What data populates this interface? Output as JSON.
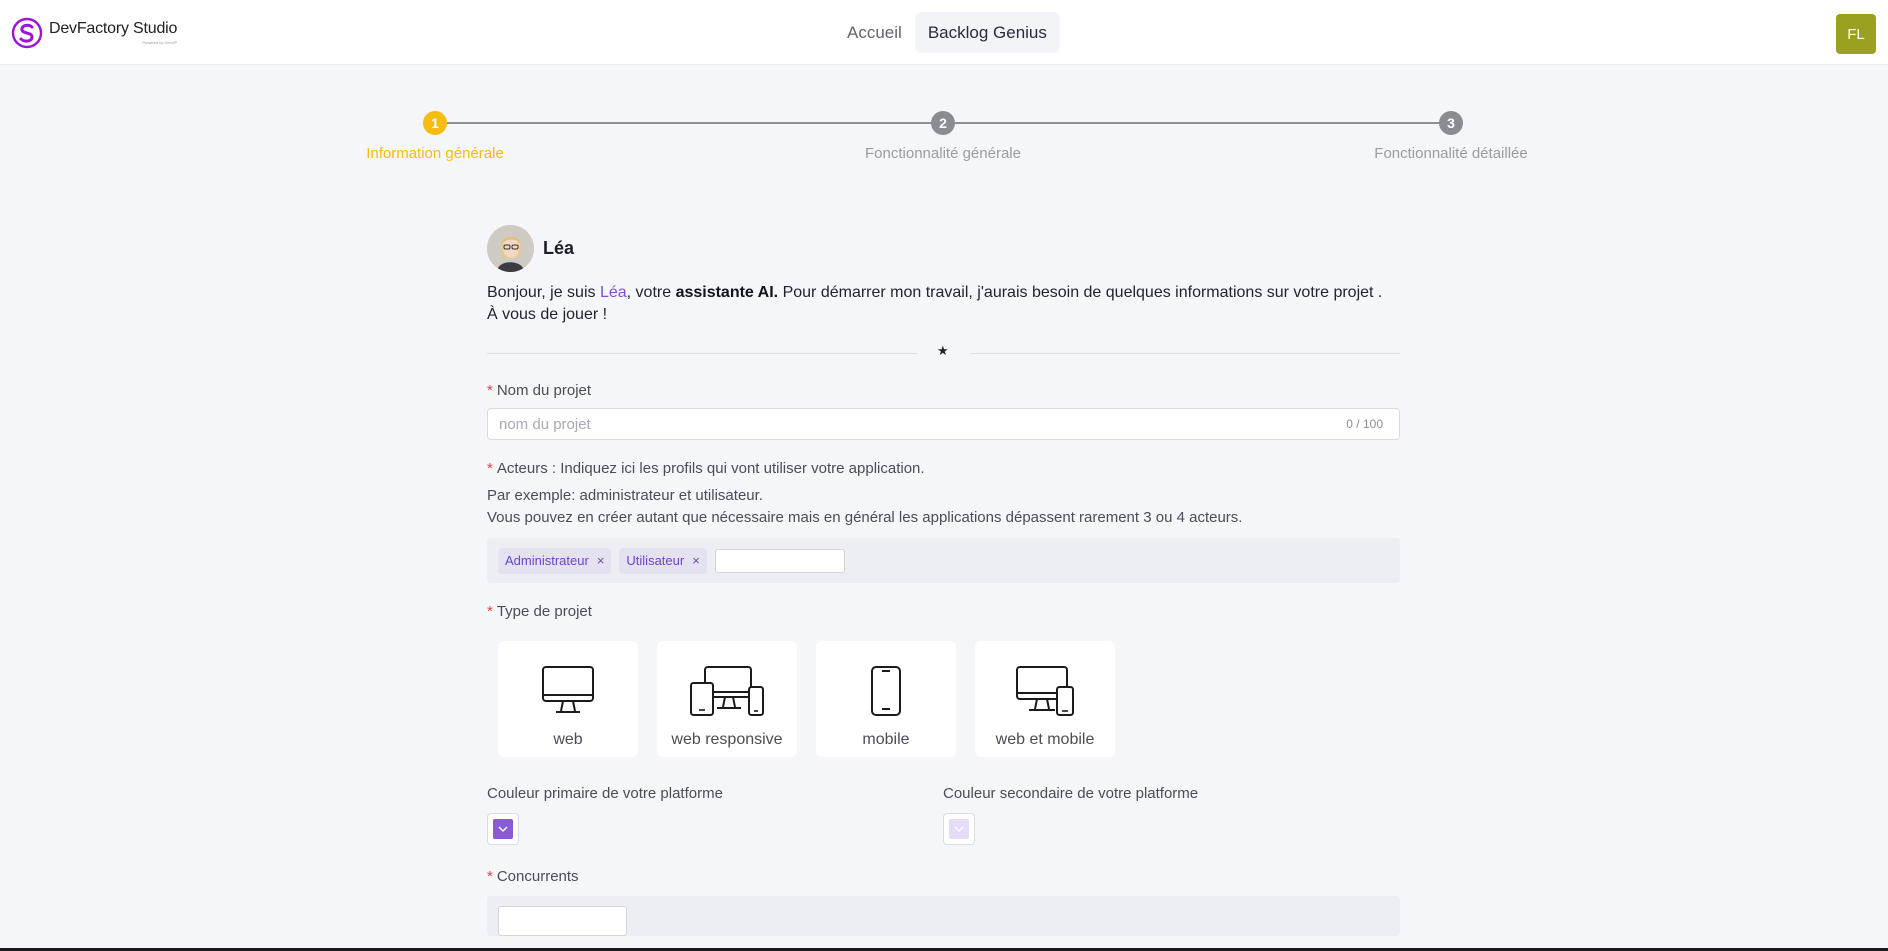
{
  "header": {
    "logo_name": "DevFactory Studio",
    "logo_sub": "Powered by DevUP",
    "nav": [
      {
        "label": "Accueil"
      },
      {
        "label": "Backlog Genius"
      }
    ],
    "user_initials": "FL",
    "brand_color": "#a012d8",
    "user_avatar_color": "#9aa01f"
  },
  "stepper": {
    "steps": [
      {
        "number": "1",
        "label": "Information générale"
      },
      {
        "number": "2",
        "label": "Fonctionnalité générale"
      },
      {
        "number": "3",
        "label": "Fonctionnalité détaillée"
      }
    ],
    "active_color": "#f6bc11"
  },
  "assistant": {
    "name": "Léa",
    "intro_part1": "Bonjour, je suis ",
    "intro_name": "Léa",
    "intro_part2": ", votre ",
    "intro_bold": "assistante AI.",
    "intro_part3": " Pour démarrer mon travail, j'aurais besoin de quelques informations sur votre projet .",
    "intro_line2": "À vous de jouer !"
  },
  "divider_symbol": "★",
  "form": {
    "required_mark": "*",
    "project_name": {
      "label": "Nom du projet",
      "placeholder": "nom du projet",
      "counter": "0 / 100"
    },
    "actors": {
      "label": "Acteurs : Indiquez ici les profils qui vont utiliser votre application.",
      "help1": "Par exemple: administrateur et utilisateur.",
      "help2": "Vous pouvez en créer autant que nécessaire mais en général les applications dépassent rarement 3 ou 4 acteurs.",
      "tags": [
        {
          "label": "Administrateur"
        },
        {
          "label": "Utilisateur"
        }
      ],
      "remove_glyph": "×"
    },
    "project_type": {
      "label": "Type de projet",
      "options": [
        {
          "label": "web",
          "icon": "desktop-icon"
        },
        {
          "label": "web responsive",
          "icon": "multi-device-icon"
        },
        {
          "label": "mobile",
          "icon": "mobile-icon"
        },
        {
          "label": "web et mobile",
          "icon": "desktop-mobile-icon"
        }
      ]
    },
    "primary_color": {
      "label": "Couleur primaire de votre platforme",
      "value": "#8a5ad8"
    },
    "secondary_color": {
      "label": "Couleur secondaire de votre platforme",
      "value": "#e6dcf8"
    },
    "competitors": {
      "label": "Concurrents"
    }
  }
}
